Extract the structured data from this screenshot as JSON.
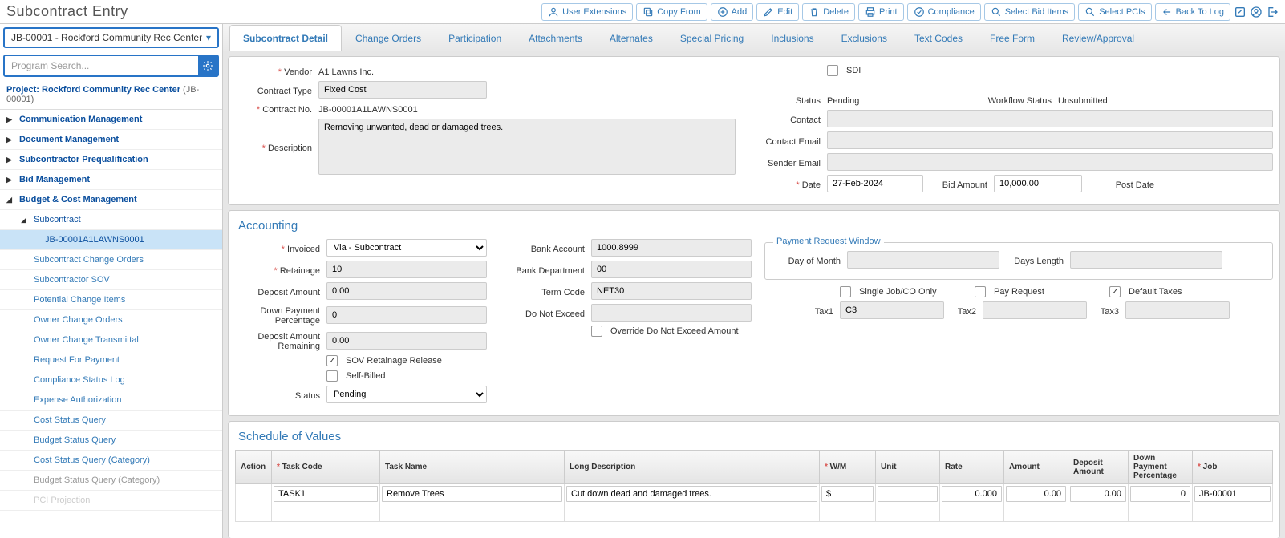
{
  "header": {
    "title": "Subcontract Entry",
    "buttons": {
      "user_ext": "User Extensions",
      "copy_from": "Copy From",
      "add": "Add",
      "edit": "Edit",
      "delete": "Delete",
      "print": "Print",
      "compliance": "Compliance",
      "select_bid": "Select Bid Items",
      "select_pci": "Select PCIs",
      "back": "Back To Log"
    }
  },
  "sidebar": {
    "project_dropdown": "JB-00001 - Rockford Community Rec Center",
    "search_placeholder": "Program Search...",
    "project_label": "Project: Rockford Community Rec Center",
    "project_id": "(JB-00001)",
    "groups": {
      "comm": "Communication Management",
      "doc": "Document Management",
      "sub_prequal": "Subcontractor Prequalification",
      "bid": "Bid Management",
      "budget": "Budget & Cost Management"
    },
    "subcontract_label": "Subcontract",
    "items": {
      "selected": "JB-00001A1LAWNS0001",
      "sco": "Subcontract Change Orders",
      "ssov": "Subcontractor SOV",
      "pci": "Potential Change Items",
      "oco": "Owner Change Orders",
      "oct": "Owner Change Transmittal",
      "rfp": "Request For Payment",
      "csl": "Compliance Status Log",
      "ea": "Expense Authorization",
      "csq": "Cost Status Query",
      "bsq": "Budget Status Query",
      "csqc": "Cost Status Query (Category)",
      "bsqc": "Budget Status Query (Category)",
      "pcip": "PCI Projection"
    }
  },
  "tabs": {
    "detail": "Subcontract Detail",
    "change": "Change Orders",
    "participation": "Participation",
    "attachments": "Attachments",
    "alternates": "Alternates",
    "pricing": "Special Pricing",
    "inclusions": "Inclusions",
    "exclusions": "Exclusions",
    "textcodes": "Text Codes",
    "freeform": "Free Form",
    "review": "Review/Approval"
  },
  "detail": {
    "vendor_label": "Vendor",
    "vendor": "A1 Lawns Inc.",
    "contract_type_label": "Contract Type",
    "contract_type": "Fixed Cost",
    "contract_no_label": "Contract No.",
    "contract_no": "JB-00001A1LAWNS0001",
    "description_label": "Description",
    "description": "Removing unwanted, dead or damaged trees.",
    "sdi_label": "SDI",
    "status_label": "Status",
    "status": "Pending",
    "workflow_status_label": "Workflow Status",
    "workflow_status": "Unsubmitted",
    "contact_label": "Contact",
    "contact": "",
    "contact_email_label": "Contact Email",
    "contact_email": "",
    "sender_email_label": "Sender Email",
    "sender_email": "",
    "date_label": "Date",
    "date": "27-Feb-2024",
    "bid_amount_label": "Bid Amount",
    "bid_amount": "10,000.00",
    "post_date_label": "Post Date",
    "post_date": ""
  },
  "accounting": {
    "title": "Accounting",
    "invoiced_label": "Invoiced",
    "invoiced": "Via - Subcontract",
    "retainage_label": "Retainage",
    "retainage": "10",
    "deposit_amount_label": "Deposit Amount",
    "deposit_amount": "0.00",
    "down_pct_label": "Down Payment Percentage",
    "down_pct": "0",
    "deposit_remaining_label": "Deposit Amount Remaining",
    "deposit_remaining": "0.00",
    "sov_retainage_label": "SOV Retainage Release",
    "self_billed_label": "Self-Billed",
    "status_label": "Status",
    "status": "Pending",
    "bank_account_label": "Bank Account",
    "bank_account": "1000.8999",
    "bank_dept_label": "Bank Department",
    "bank_dept": "00",
    "term_code_label": "Term Code",
    "term_code": "NET30",
    "dne_label": "Do Not Exceed",
    "dne": "",
    "override_dne_label": "Override Do Not Exceed Amount",
    "prw_title": "Payment Request Window",
    "day_of_month_label": "Day of Month",
    "day_of_month": "",
    "days_length_label": "Days Length",
    "days_length": "",
    "single_job_label": "Single Job/CO Only",
    "pay_request_label": "Pay Request",
    "default_taxes_label": "Default Taxes",
    "tax1_label": "Tax1",
    "tax1": "C3",
    "tax2_label": "Tax2",
    "tax2": "",
    "tax3_label": "Tax3",
    "tax3": ""
  },
  "sov": {
    "title": "Schedule of Values",
    "headers": {
      "action": "Action",
      "task_code": "Task Code",
      "task_name": "Task Name",
      "long_desc": "Long Description",
      "wm": "W/M",
      "unit": "Unit",
      "rate": "Rate",
      "amount": "Amount",
      "deposit": "Deposit Amount",
      "down_pct": "Down Payment Percentage",
      "job": "Job"
    },
    "row": {
      "task_code": "TASK1",
      "task_name": "Remove Trees",
      "long_desc": "Cut down dead and damaged trees.",
      "wm": "$",
      "unit": "",
      "rate": "0.000",
      "amount": "0.00",
      "deposit": "0.00",
      "down_pct": "0",
      "job": "JB-00001"
    }
  }
}
